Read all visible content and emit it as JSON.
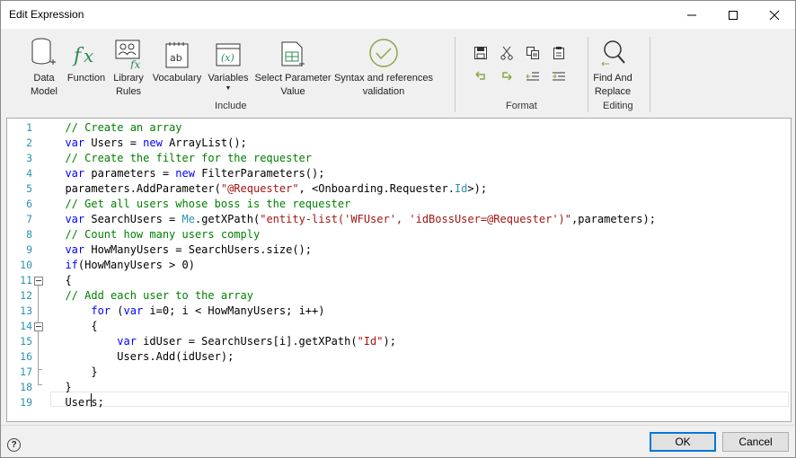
{
  "window": {
    "title": "Edit Expression"
  },
  "ribbon": {
    "include": {
      "label": "Include",
      "buttons": [
        {
          "label": "Data\nModel",
          "icon": "data-model-icon"
        },
        {
          "label": "Function",
          "icon": "function-icon"
        },
        {
          "label": "Library\nRules",
          "icon": "library-rules-icon"
        },
        {
          "label": "Vocabulary",
          "icon": "vocabulary-icon"
        },
        {
          "label": "Variables",
          "icon": "variables-icon"
        },
        {
          "label": "Select Parameter\nValue",
          "icon": "select-parameter-icon"
        },
        {
          "label": "Syntax and references\nvalidation",
          "icon": "validation-check-icon"
        }
      ]
    },
    "format": {
      "label": "Format"
    },
    "editing": {
      "label": "Editing",
      "find_replace": "Find And\nReplace"
    }
  },
  "editor": {
    "line_numbers": [
      "1",
      "2",
      "3",
      "4",
      "5",
      "6",
      "7",
      "8",
      "9",
      "10",
      "11",
      "12",
      "13",
      "14",
      "15",
      "16",
      "17",
      "18",
      "19"
    ],
    "lines": [
      "  // Create an array",
      "  var Users = new ArrayList();",
      "  // Create the filter for the requester",
      "  var parameters = new FilterParameters();",
      "  parameters.AddParameter(\"@Requester\", <Onboarding.Requester.Id>);",
      "  // Get all users whose boss is the requester",
      "  var SearchUsers = Me.getXPath(\"entity-list('WFUser', 'idBossUser=@Requester')\",parameters);",
      "  // Count how many users comply",
      "  var HowManyUsers = SearchUsers.size();",
      "  if(HowManyUsers > 0)",
      "  {",
      "  // Add each user to the array",
      "      for (var i=0; i < HowManyUsers; i++)",
      "      {",
      "          var idUser = SearchUsers[i].getXPath(\"Id\");",
      "          Users.Add(idUser);",
      "      }",
      "  }",
      "  Users;"
    ]
  },
  "footer": {
    "ok_label": "OK",
    "cancel_label": "Cancel",
    "help_label": "?"
  }
}
